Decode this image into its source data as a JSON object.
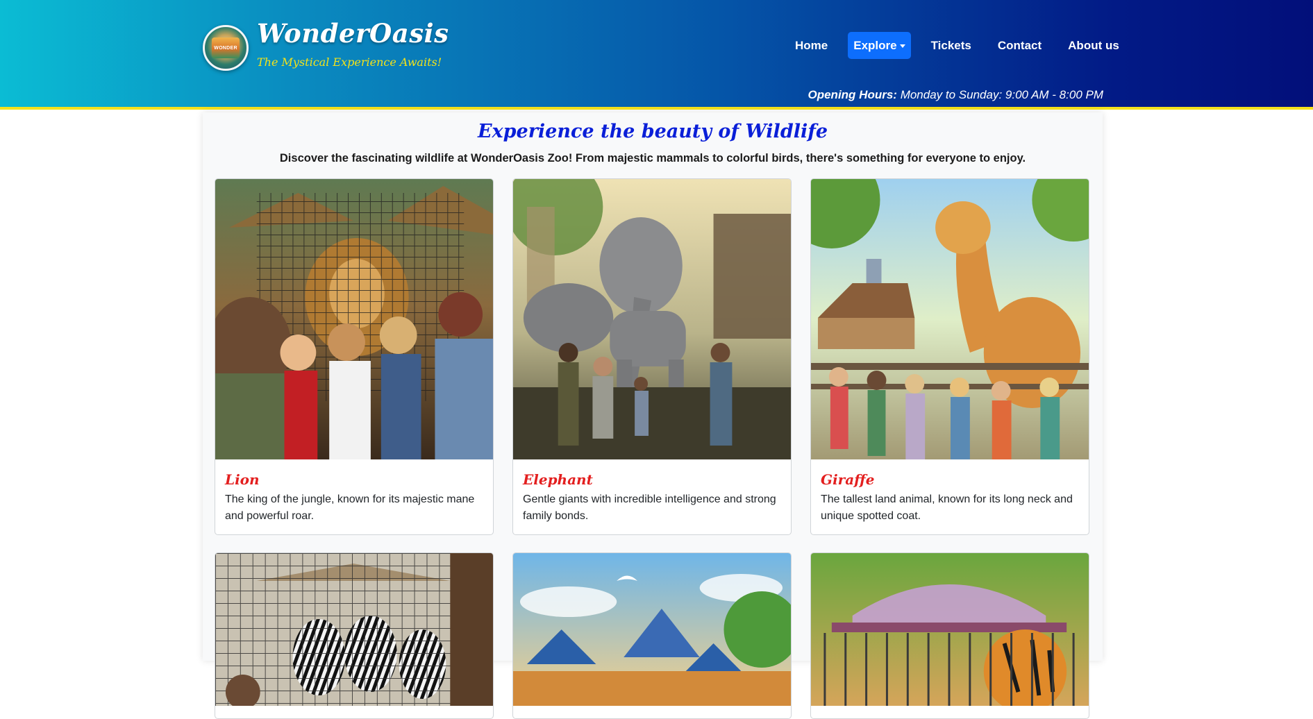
{
  "brand": {
    "title": "WonderOasis",
    "tagline": "The Mystical Experience Awaits!",
    "logo_text": "WONDER"
  },
  "nav": {
    "items": [
      {
        "label": "Home"
      },
      {
        "label": "Explore"
      },
      {
        "label": "Tickets"
      },
      {
        "label": "Contact"
      },
      {
        "label": "About us"
      }
    ]
  },
  "hours": {
    "label": "Opening Hours:",
    "value": "Monday to Sunday: 9:00 AM - 8:00 PM"
  },
  "main": {
    "title": "Experience the beauty of Wildlife",
    "intro": "Discover the fascinating wildlife at WonderOasis Zoo! From majestic mammals to colorful birds, there's something for everyone to enjoy.",
    "cards": [
      {
        "title": "Lion",
        "text": "The king of the jungle, known for its majestic mane and powerful roar."
      },
      {
        "title": "Elephant",
        "text": "Gentle giants with incredible intelligence and strong family bonds."
      },
      {
        "title": "Giraffe",
        "text": "The tallest land animal, known for its long neck and unique spotted coat."
      }
    ]
  },
  "colors": {
    "header_gradient_start": "#0bbcd4",
    "header_gradient_end": "#020f7a",
    "header_border": "#f5e21c",
    "tagline": "#f3e21a",
    "nav_active": "#0d6efd",
    "section_title": "#0a1fd8",
    "card_title": "#e31f1f"
  }
}
